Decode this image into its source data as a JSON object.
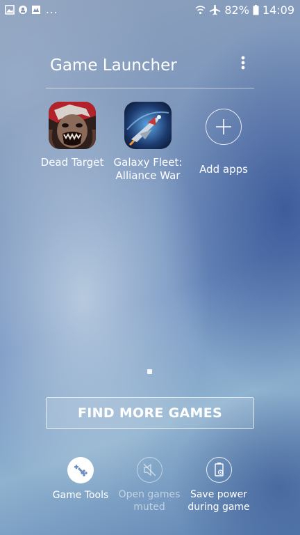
{
  "status_bar": {
    "left_icons": [
      "gallery-icon",
      "vpn-icon",
      "image-message-icon"
    ],
    "overflow_indicator": "...",
    "battery_percent": "82%",
    "time": "14:09"
  },
  "header": {
    "title": "Game Launcher",
    "menu_icon": "more-vert-icon"
  },
  "games": [
    {
      "label": "Dead Target",
      "icon": "dead-target-icon"
    },
    {
      "label": "Galaxy Fleet:\nAlliance War",
      "icon": "galaxy-fleet-icon"
    }
  ],
  "add_apps": {
    "label": "Add apps",
    "icon": "plus-icon"
  },
  "pager": {
    "current_page": 1,
    "total_pages": 1
  },
  "find_more_button": {
    "label": "FIND MORE GAMES"
  },
  "bottom_tools": [
    {
      "label": "Game Tools",
      "icon": "gamepad-icon",
      "enabled": true
    },
    {
      "label": "Open games\nmuted",
      "icon": "mute-icon",
      "enabled": false
    },
    {
      "label": "Save power\nduring game",
      "icon": "battery-saver-icon",
      "enabled": true
    }
  ]
}
